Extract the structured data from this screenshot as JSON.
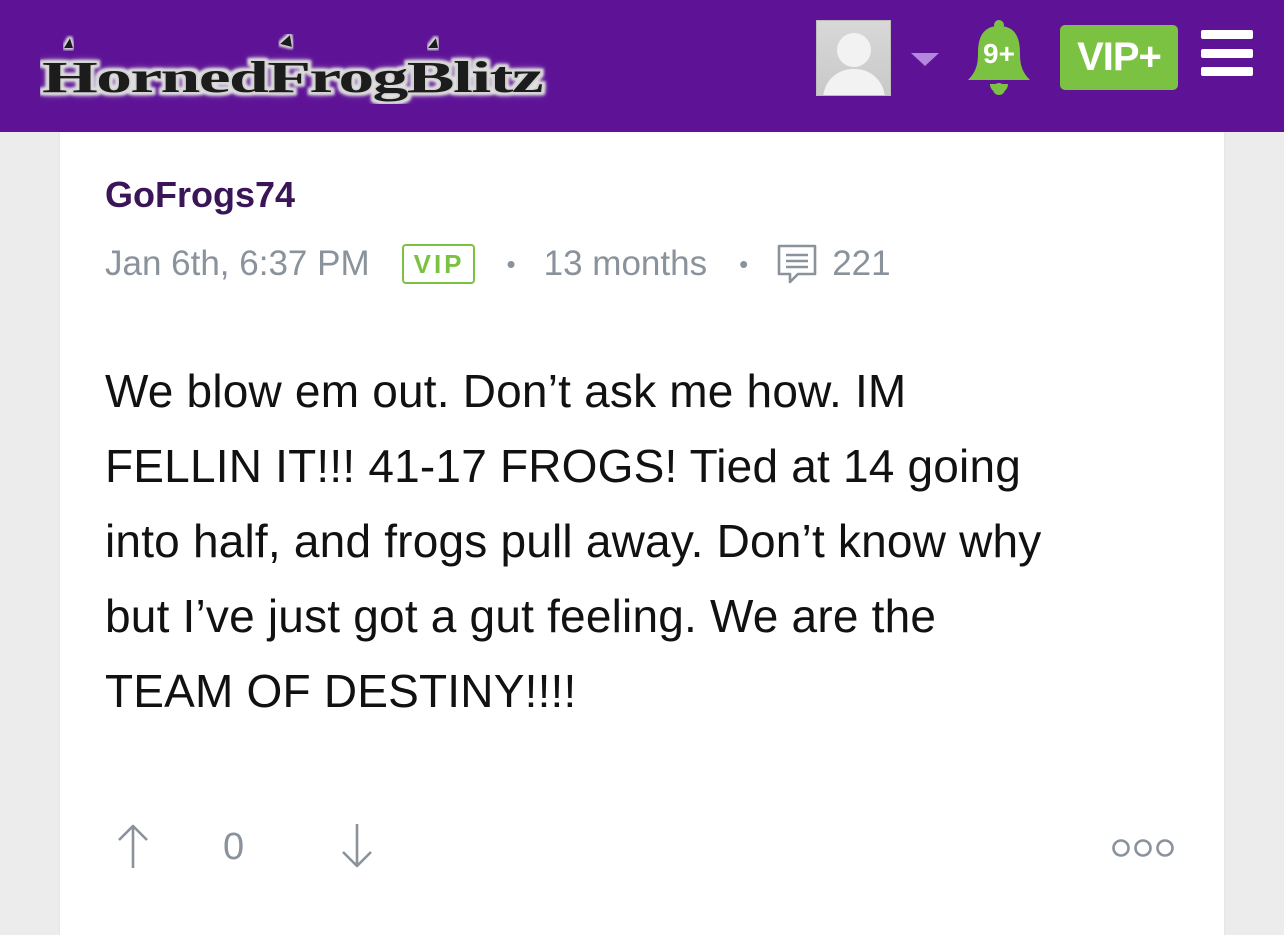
{
  "header": {
    "logo_text": "HornedFrogBlitz",
    "notifications_badge": "9+",
    "vip_plus_label": "VIP+",
    "icons": {
      "avatar": "user-avatar-placeholder",
      "dropdown": "chevron-down-icon",
      "bell": "bell-icon",
      "menu": "hamburger-menu-icon"
    },
    "colors": {
      "bar": "#5e1396",
      "vip_button": "#7cc242",
      "bell": "#7cc242"
    }
  },
  "post": {
    "author": "GoFrogs74",
    "timestamp": "Jan 6th, 6:37 PM",
    "badge": "VIP",
    "member_for": "13 months",
    "reply_count": "221",
    "body_lines": [
      "We blow em out. Don’t ask me how. IM",
      "FELLIN IT!!! 41-17 FROGS! Tied at 14 going",
      "into half, and frogs pull away. Don’t know why",
      "but I’ve just got a gut feeling. We are the",
      "TEAM OF DESTINY!!!!"
    ],
    "vote_count": "0",
    "icons": {
      "comments": "speech-bubble-icon",
      "upvote": "arrow-up-icon",
      "downvote": "arrow-down-icon",
      "more": "more-options-icon"
    },
    "colors": {
      "author": "#3a1658",
      "meta": "#8a929c",
      "vip_badge": "#7cc242"
    }
  }
}
